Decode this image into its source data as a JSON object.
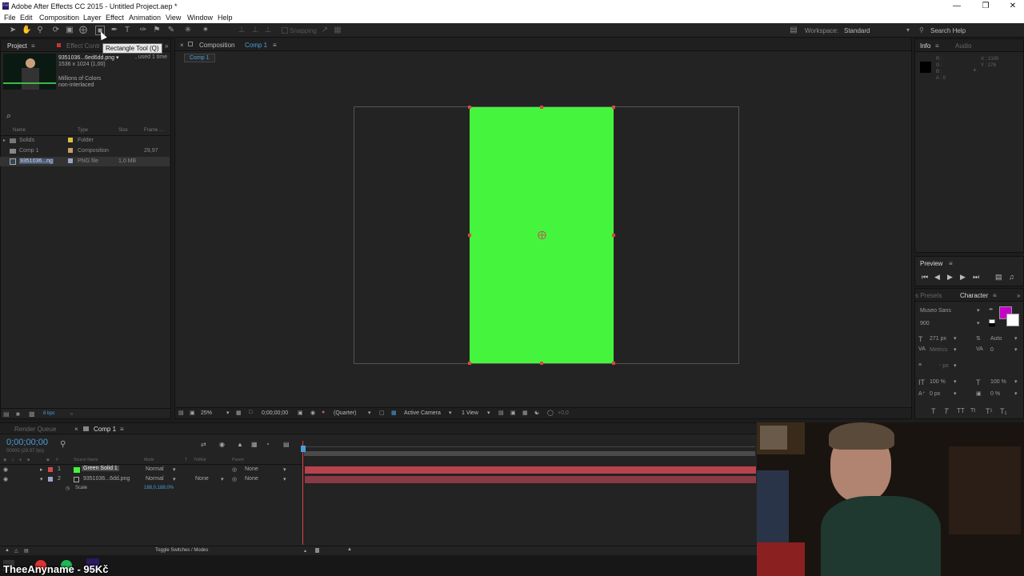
{
  "window": {
    "title": "Adobe After Effects CC 2015 - Untitled Project.aep *",
    "app_icon": "Ae"
  },
  "menu": [
    "File",
    "Edit",
    "Composition",
    "Layer",
    "Effect",
    "Animation",
    "View",
    "Window",
    "Help"
  ],
  "toolbar": {
    "tooltip": "Rectangle Tool (Q)",
    "snapping": "Snapping",
    "workspace_label": "Workspace:",
    "workspace_value": "Standard",
    "search_help": "Search Help"
  },
  "project": {
    "tab": "Project",
    "effect_tab": "Effect Contr",
    "asset_name": "9351036...6ed6dd.png ▾",
    "used": ", used 1 time",
    "dims": "1536 x 1024 (1,00)",
    "colors": "Millions of Colors",
    "interlace": "non-interlaced",
    "search_icon": "⌕",
    "headers": {
      "name": "Name",
      "type": "Type",
      "size": "Size",
      "frame": "Frame ..."
    },
    "items": [
      {
        "name": "Solids",
        "type": "Folder",
        "size": "",
        "frame": "",
        "color": "#d8c23a"
      },
      {
        "name": "Comp 1",
        "type": "Composition",
        "size": "",
        "frame": "29,97",
        "color": "#c9a064"
      },
      {
        "name": "9351036...ng",
        "type": "PNG file",
        "size": "1,0 MB",
        "frame": "",
        "color": "#9aa6c8"
      }
    ],
    "bpc": "8 bpc"
  },
  "composition": {
    "tab": "Composition",
    "comp_name": "Comp 1",
    "sub_tab": "Comp 1",
    "footer": {
      "zoom": "25%",
      "timecode": "0;00;00;00",
      "resolution": "(Quarter)",
      "camera": "Active Camera",
      "views": "1 View",
      "exposure": "+0,0"
    },
    "solid_color": "#45f53d"
  },
  "info": {
    "tab": "Info",
    "audio_tab": "Audio",
    "r": "R :",
    "g": "G :",
    "b": "B :",
    "a": "A : 0",
    "x": "X : 2100",
    "y": "Y : 276"
  },
  "preview": {
    "tab": "Preview"
  },
  "character": {
    "presets_tab": "s Presets",
    "tab": "Character",
    "font": "Museo Sans",
    "weight": "900",
    "size": "271 px",
    "leading": "Auto",
    "kerning": "Metrics",
    "tracking": "0",
    "stroke": "- px",
    "vscale": "100 %",
    "hscale": "100 %",
    "baseline": "0 px",
    "tsume": "0 %",
    "fill_color": "#c800c8"
  },
  "timeline": {
    "render_queue_tab": "Render Queue",
    "comp_tab": "Comp 1",
    "timecode": "0;00;00;00",
    "fps": "00000 (29.97 fps)",
    "headers": {
      "num": "#",
      "source": "Source Name",
      "mode": "Mode",
      "t": "T",
      "trkmat": "TrkMat",
      "parent": "Parent"
    },
    "layers": [
      {
        "num": "1",
        "name": "Green Solid 1",
        "mode": "Normal",
        "trkmat": "",
        "parent": "None",
        "color": "#d44a4a",
        "swatch": "#45f53d"
      },
      {
        "num": "2",
        "name": "9351036...6dd.png",
        "mode": "Normal",
        "trkmat": "None",
        "parent": "None",
        "color": "#9aa6c8",
        "swatch": "#6a6a8a"
      }
    ],
    "scale_label": "Scale",
    "scale_value": "188,0,188,0%",
    "toggle": "Toggle Switches / Modes"
  },
  "taskbar": {
    "overlay_text": "TheeAnyname - 95Kč"
  }
}
